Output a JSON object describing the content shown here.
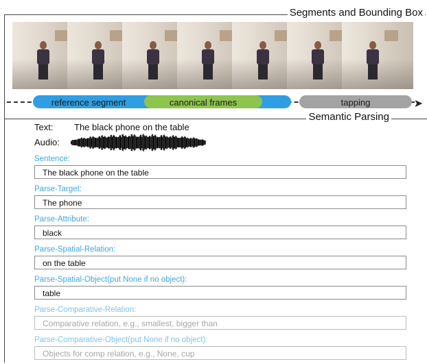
{
  "sections": {
    "segments_title": "Segments and Bounding Box",
    "semantic_title": "Semantic Parsing"
  },
  "timeline": {
    "reference_segment": "reference segment",
    "canonical_frames": "canonical frames",
    "tapping": "tapping"
  },
  "query": {
    "text_label": "Text:",
    "text_value": "The black phone on the table",
    "audio_label": "Audio:"
  },
  "fields": [
    {
      "label": "Sentence:",
      "value": "The black phone on the table",
      "placeholder": ""
    },
    {
      "label": "Parse-Target:",
      "value": "The phone",
      "placeholder": ""
    },
    {
      "label": "Parse-Attribute:",
      "value": "black",
      "placeholder": ""
    },
    {
      "label": "Parse-Spatial-Relation:",
      "value": "on the table",
      "placeholder": ""
    },
    {
      "label": "Parse-Spatial-Object(put None if no object):",
      "value": "table",
      "placeholder": ""
    },
    {
      "label": "Parse-Comparative-Relation:",
      "value": "",
      "placeholder": "Comparative relation, e.g., smallest, bigger than"
    },
    {
      "label": "Parse-Comparative-Object(put None if no object):",
      "value": "",
      "placeholder": "Objects for comp relation, e.g., None, cup"
    }
  ],
  "colors": {
    "reference": "#2f9ee2",
    "canonical": "#8ec54e",
    "tapping": "#a3a3a3",
    "label_blue": "#3fa6e3"
  }
}
